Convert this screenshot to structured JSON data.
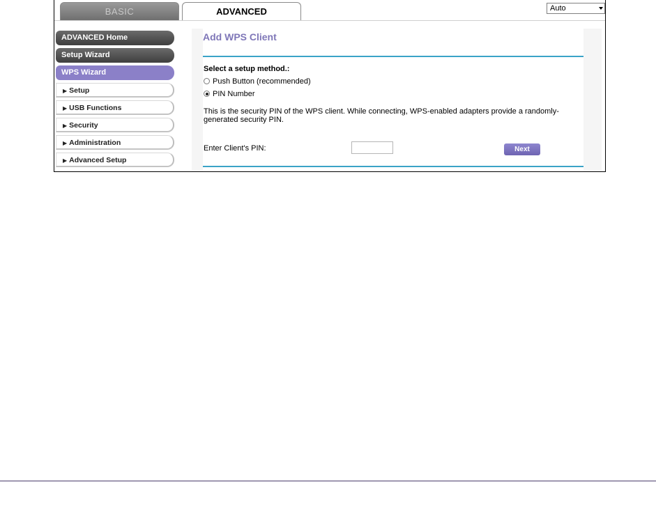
{
  "tabs": {
    "basic": "BASIC",
    "advanced": "ADVANCED"
  },
  "language_select": {
    "value": "Auto"
  },
  "menu": {
    "items": [
      {
        "label": "ADVANCED Home"
      },
      {
        "label": "Setup Wizard"
      },
      {
        "label": "WPS Wizard"
      },
      {
        "label": "Setup"
      },
      {
        "label": "USB Functions"
      },
      {
        "label": "Security"
      },
      {
        "label": "Administration"
      },
      {
        "label": "Advanced Setup"
      }
    ]
  },
  "main": {
    "title": "Add WPS Client",
    "method_label": "Select a setup method.:",
    "options": [
      {
        "label": "Push Button (recommended)",
        "selected": false
      },
      {
        "label": "PIN Number",
        "selected": true
      }
    ],
    "description": "This is the security PIN of the WPS client. While connecting, WPS-enabled adapters provide a randomly-generated security PIN.",
    "pin_label": "Enter Client's PIN:",
    "pin_value": "",
    "next_label": "Next"
  },
  "colors": {
    "accent_purple": "#8b80c8",
    "title_purple": "#7f77b8",
    "rule_blue": "#3aa3c7"
  }
}
